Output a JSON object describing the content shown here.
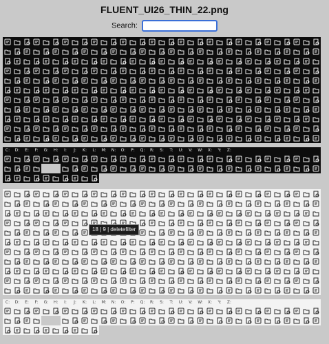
{
  "title": "FLUENT_UI26_THIN_22.png",
  "search": {
    "label": "Search:",
    "value": "",
    "placeholder": ""
  },
  "sheet_letters": [
    "C:",
    "D:",
    "E:",
    "F:",
    "G:",
    "H:",
    "I:",
    "J:",
    "K:",
    "L:",
    "M:",
    "N:",
    "O:",
    "P:",
    "Q:",
    "R:",
    "S:",
    "T:",
    "U:",
    "V:",
    "W:",
    "X:",
    "Y:",
    "Z:"
  ],
  "tooltip": {
    "text": "18 | 9 | deletefilter"
  },
  "colors": {
    "background": "#c9c9c9",
    "dark_cell": "#0d0d0d",
    "light_cell": "#f3f3f3",
    "search_border": "#3a6fd8"
  }
}
